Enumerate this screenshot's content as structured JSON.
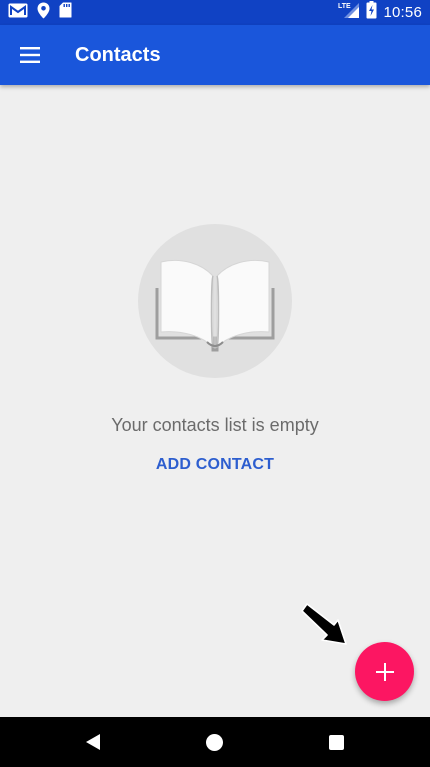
{
  "status_bar": {
    "time": "10:56",
    "network_label": "LTE",
    "icons": [
      "gmail-icon",
      "location-pin-icon",
      "sd-card-icon",
      "signal-icon",
      "battery-charging-icon"
    ]
  },
  "app_bar": {
    "title": "Contacts",
    "menu_icon": "hamburger-menu-icon"
  },
  "empty_state": {
    "illustration_icon": "open-book-icon",
    "message": "Your contacts list is empty",
    "action_label": "ADD CONTACT"
  },
  "fab": {
    "icon": "plus-icon"
  },
  "nav_bar": {
    "icons": [
      "back-icon",
      "home-icon",
      "recents-icon"
    ]
  },
  "colors": {
    "status_bar": "#1042c4",
    "app_bar": "#1a56db",
    "background": "#efefef",
    "accent_link": "#2d5ecf",
    "fab": "#fc1662",
    "nav_bar": "#000000"
  }
}
